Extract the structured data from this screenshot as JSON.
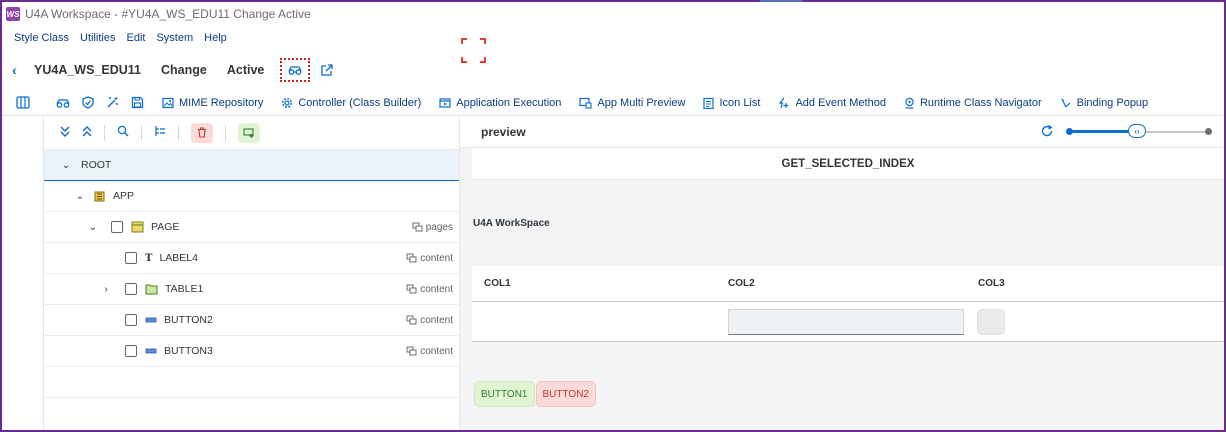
{
  "window": {
    "title": "U4A Workspace - #YU4A_WS_EDU11 Change Active",
    "logo_text": "WS"
  },
  "menu": [
    "Style Class",
    "Utilities",
    "Edit",
    "System",
    "Help"
  ],
  "header": {
    "app_id": "YU4A_WS_EDU11",
    "mode": "Change",
    "status": "Active"
  },
  "toolbar": {
    "items": [
      {
        "label": "MIME Repository",
        "icon": "image-icon"
      },
      {
        "label": "Controller (Class Builder)",
        "icon": "gear-icon"
      },
      {
        "label": "Application Execution",
        "icon": "run-icon"
      },
      {
        "label": "App Multi Preview",
        "icon": "multi-preview-icon"
      },
      {
        "label": "Icon List",
        "icon": "list-icon"
      },
      {
        "label": "Add Event Method",
        "icon": "add-event-icon"
      },
      {
        "label": "Runtime Class Navigator",
        "icon": "navigator-icon"
      },
      {
        "label": "Binding Popup",
        "icon": "binding-icon"
      }
    ]
  },
  "tree": {
    "rows": [
      {
        "label": "ROOT",
        "agg": ""
      },
      {
        "label": "APP",
        "agg": ""
      },
      {
        "label": "PAGE",
        "agg": "pages"
      },
      {
        "label": "LABEL4",
        "agg": "content"
      },
      {
        "label": "TABLE1",
        "agg": "content"
      },
      {
        "label": "BUTTON2",
        "agg": "content"
      },
      {
        "label": "BUTTON3",
        "agg": "content"
      }
    ]
  },
  "preview": {
    "title": "preview",
    "page_title": "GET_SELECTED_INDEX",
    "label_text": "U4A WorkSpace",
    "columns": [
      "COL1",
      "COL2",
      "COL3"
    ],
    "buttons": [
      "BUTTON1",
      "BUTTON2"
    ]
  },
  "colors": {
    "frame": "#6a2c91",
    "accent": "#0a6ed1",
    "menu_text": "#0a3d80",
    "highlight_border": "#cc2222",
    "delete_bg": "#fbdada",
    "add_bg": "#e1f5d5"
  }
}
